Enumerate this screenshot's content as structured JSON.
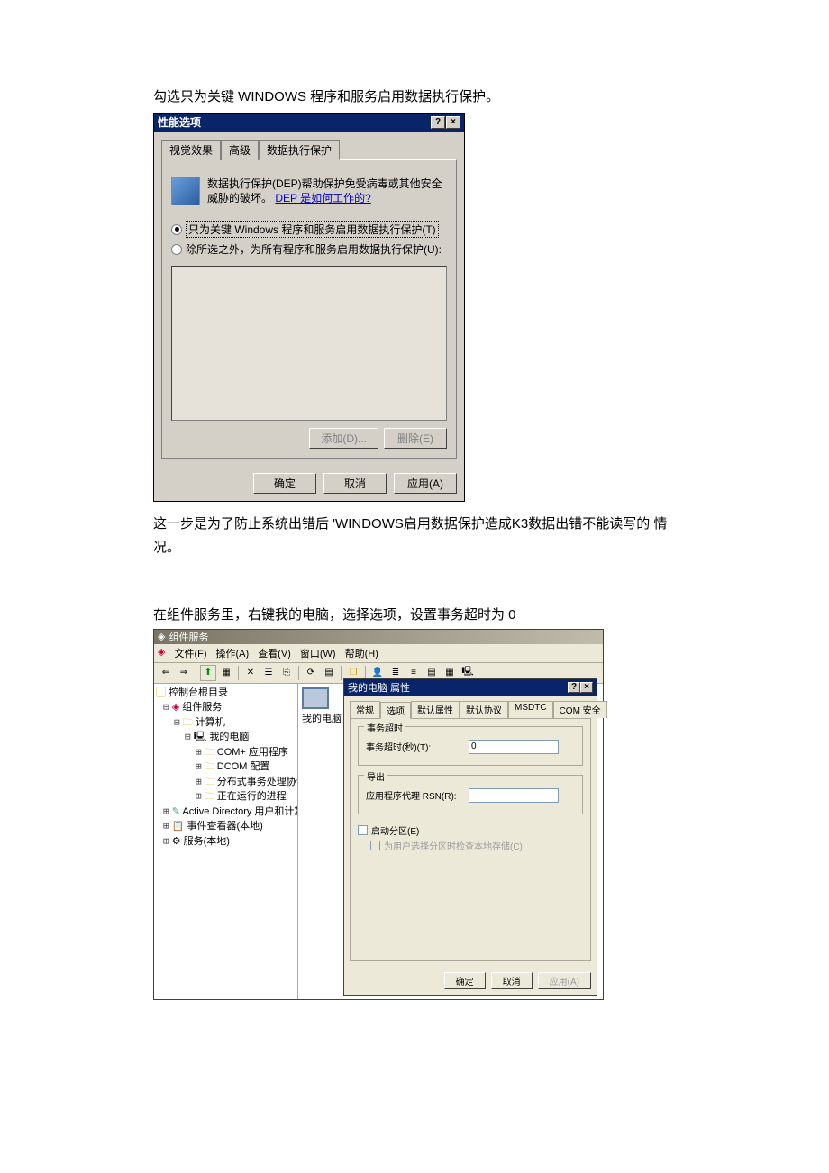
{
  "intro1": "勾选只为关键 WINDOWS 程序和服务启用数据执行保护。",
  "dialog1": {
    "title": "性能选项",
    "help_btn": "?",
    "close_btn": "×",
    "tabs": {
      "t1": "视觉效果",
      "t2": "高级",
      "t3": "数据执行保护"
    },
    "dep_desc": "数据执行保护(DEP)帮助保护免受病毒或其他安全威胁的破坏。",
    "dep_link": "DEP 是如何工作的?",
    "radio1": "只为关键 Windows 程序和服务启用数据执行保护(T)",
    "radio2": "除所选之外，为所有程序和服务启用数据执行保护(U):",
    "add_btn": "添加(D)...",
    "remove_btn": "删除(E)",
    "ok": "确定",
    "cancel": "取消",
    "apply": "应用(A)"
  },
  "after1": "这一步是为了防止系统出错后 'WINDOWS启用数据保护造成K3数据出错不能读写的 情况。",
  "intro2": "在组件服务里，右键我的电脑，选择选项，设置事务超时为 0",
  "cs": {
    "title": "组件服务",
    "menu": {
      "file": "文件(F)",
      "action": "操作(A)",
      "view": "查看(V)",
      "window": "窗口(W)",
      "help": "帮助(H)"
    },
    "tree": {
      "root": "控制台根目录",
      "svc": "组件服务",
      "comp": "计算机",
      "mypc": "我的电脑",
      "com_apps": "COM+ 应用程序",
      "dcom": "DCOM 配置",
      "dtc": "分布式事务处理协调",
      "running": "正在运行的进程",
      "ad": "Active Directory 用户和计算",
      "evt": "事件查看器(本地)",
      "srv": "服务(本地)"
    },
    "right_label": "我的电脑"
  },
  "dialog2": {
    "title": "我的电脑 属性",
    "tabs": {
      "t1": "常规",
      "t2": "选项",
      "t3": "默认属性",
      "t4": "默认协议",
      "t5": "MSDTC",
      "t6": "COM 安全"
    },
    "group_timeout": "事务超时",
    "timeout_label": "事务超时(秒)(T):",
    "timeout_value": "0",
    "group_export": "导出",
    "export_label": "应用程序代理 RSN(R):",
    "export_value": "",
    "cb_boot": "启动分区(E)",
    "cb_check": "为用户选择分区时检查本地存储(C)",
    "ok": "确定",
    "cancel": "取消",
    "apply": "应用(A)"
  }
}
